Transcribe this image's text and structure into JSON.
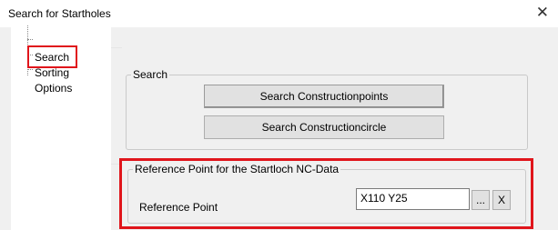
{
  "window": {
    "title": "Search for Startholes",
    "close_glyph": "✕"
  },
  "tree": {
    "items": [
      {
        "label": "Search",
        "selected": true
      },
      {
        "label": "Sorting",
        "selected": false
      },
      {
        "label": "Options",
        "selected": false
      }
    ]
  },
  "search_group": {
    "label": "Search",
    "buttons": [
      "Search Constructionpoints",
      "Search Constructioncircle"
    ]
  },
  "reference_group": {
    "label": "Reference Point for the Startloch NC-Data",
    "field_label": "Reference Point",
    "field_value": "X110 Y25",
    "browse_label": "...",
    "clear_label": "X"
  },
  "colors": {
    "highlight": "#e0151b",
    "background": "#f0f0f0"
  }
}
